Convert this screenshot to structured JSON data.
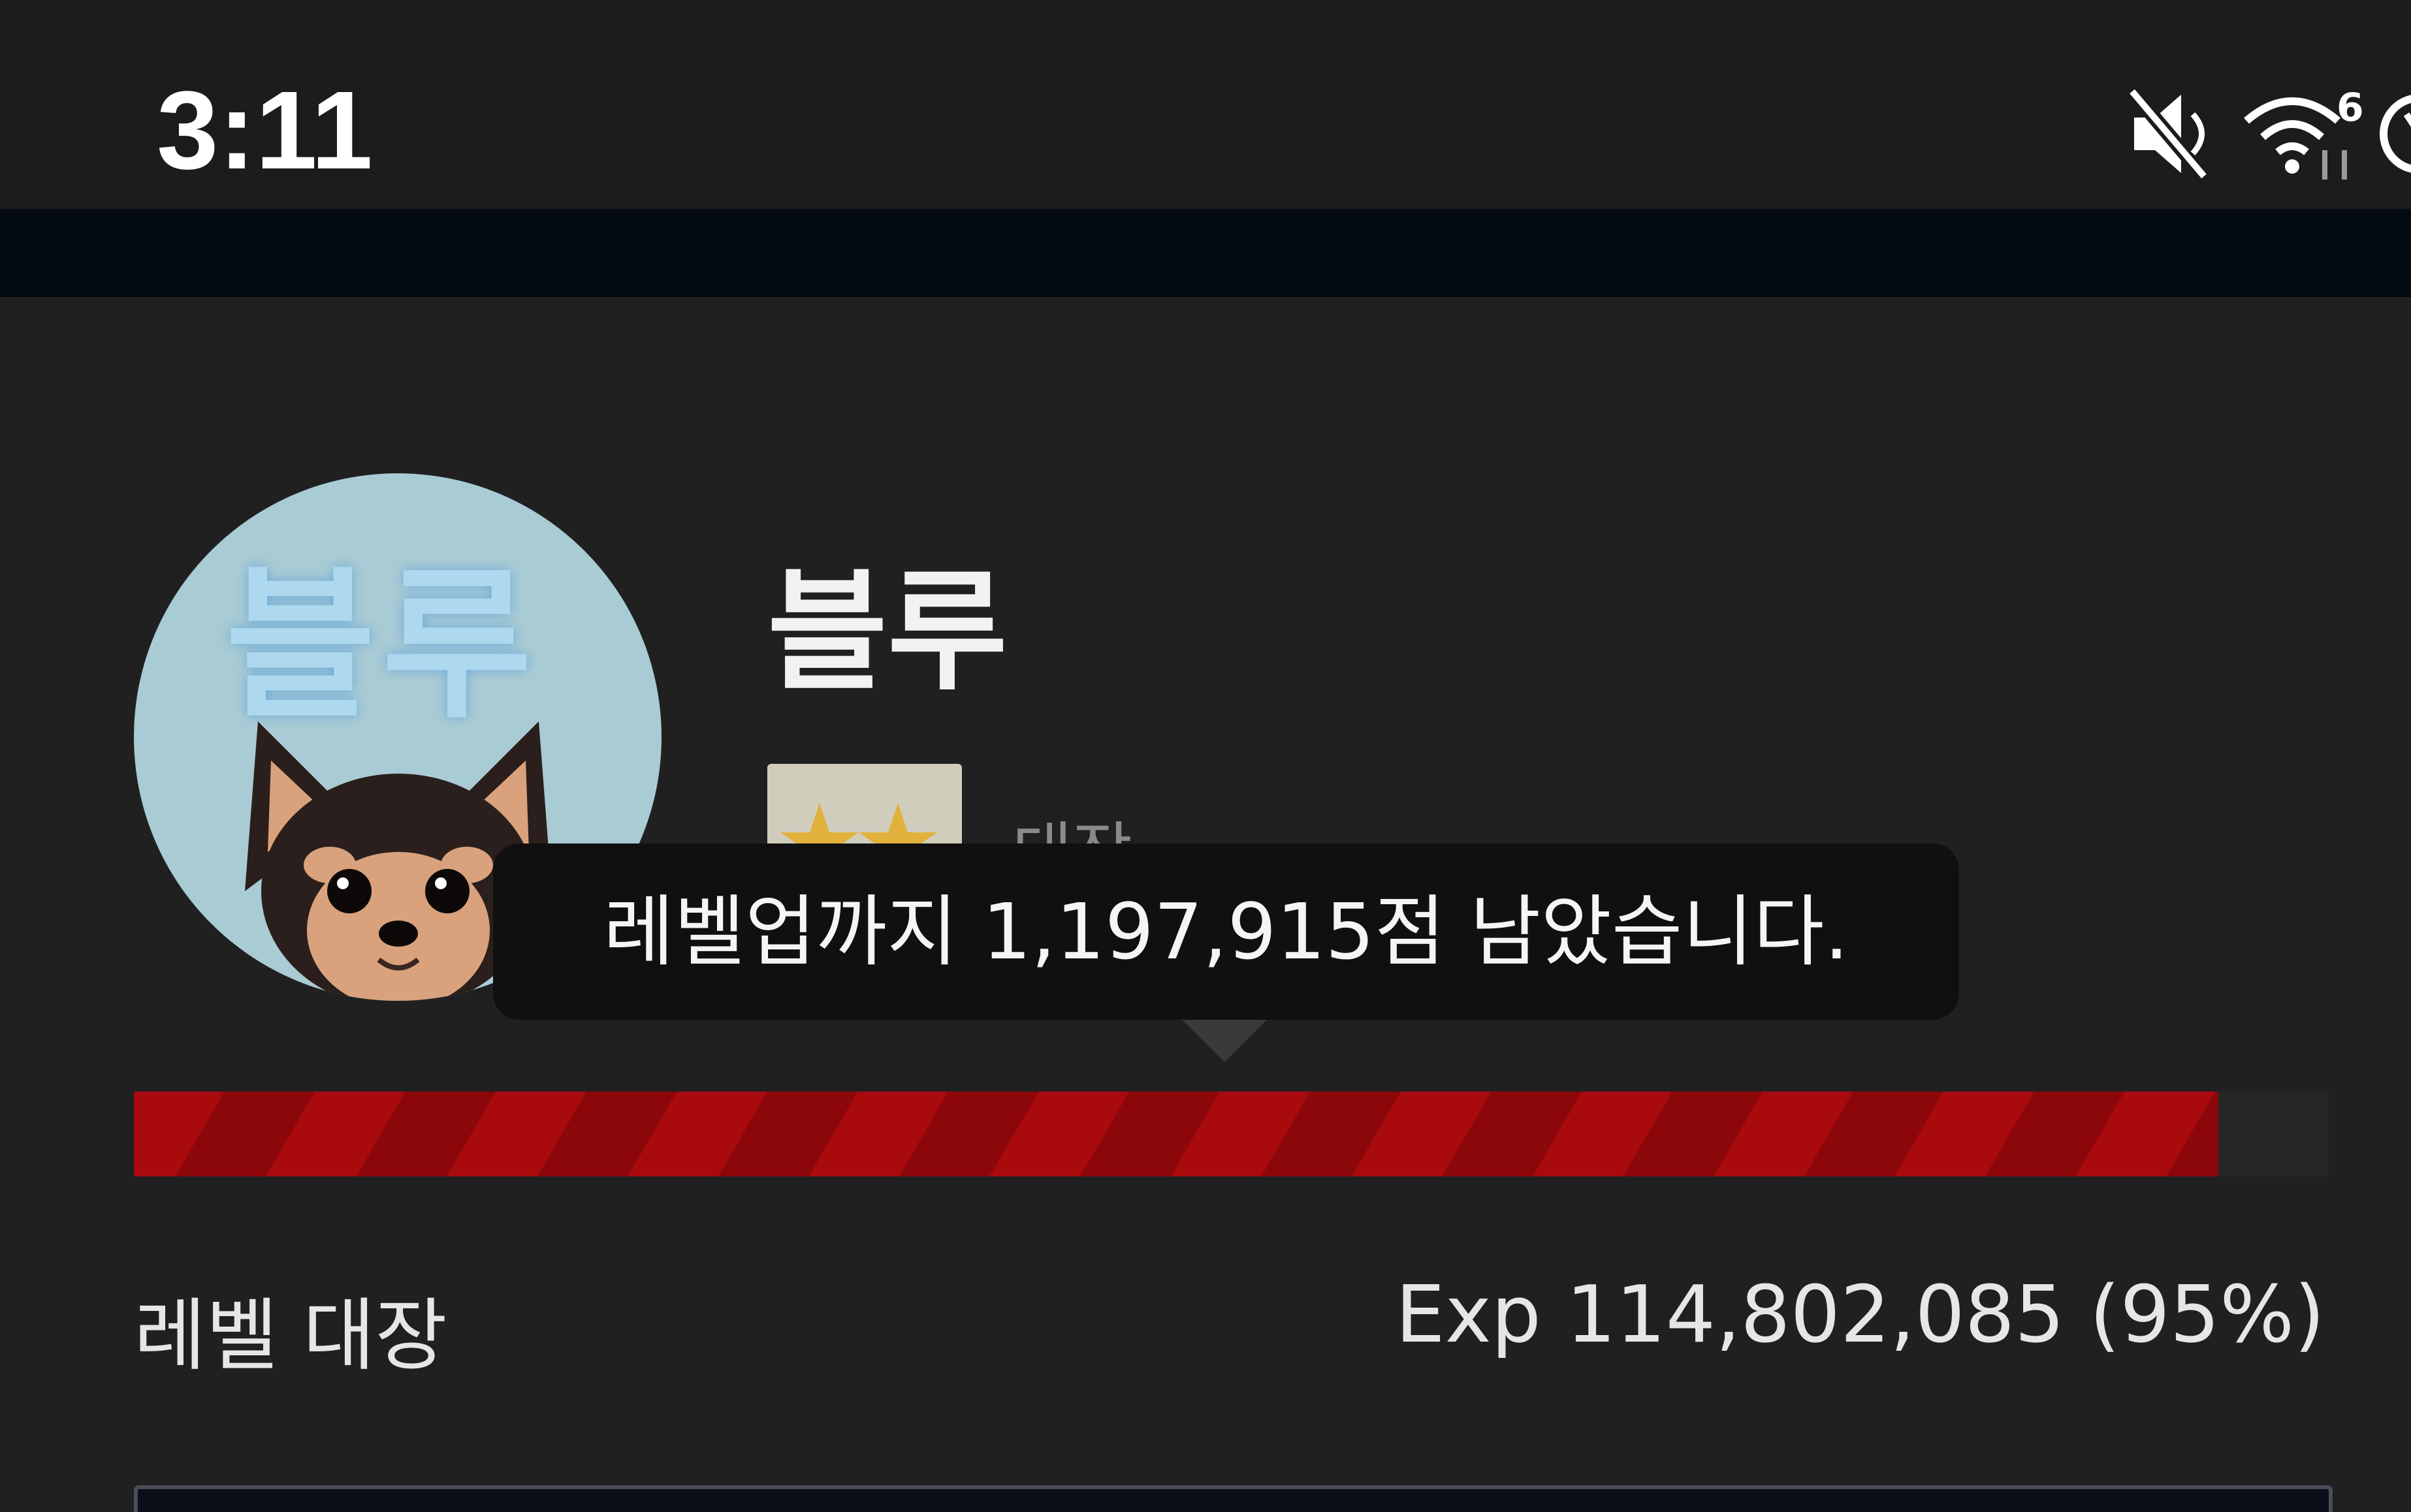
{
  "status_bar": {
    "time": "3:11",
    "icons": [
      "mute-icon",
      "wifi-icon",
      "alarm-icon"
    ],
    "wifi_label": "6"
  },
  "profile": {
    "name": "블루",
    "avatar_text": "블루",
    "rank_label": "대장"
  },
  "tooltip": {
    "text": "레벨업까지 1,197,915점 남았습니다."
  },
  "progress": {
    "percent": 95,
    "fill_color": "#a80a0e",
    "level_text": "레벨 대장",
    "exp_text": "Exp 114,802,085 (95%)"
  },
  "colors": {
    "background": "#202021",
    "status_bar": "#1c1c1d",
    "header_strip": "#040a12",
    "tooltip": "#101011"
  }
}
